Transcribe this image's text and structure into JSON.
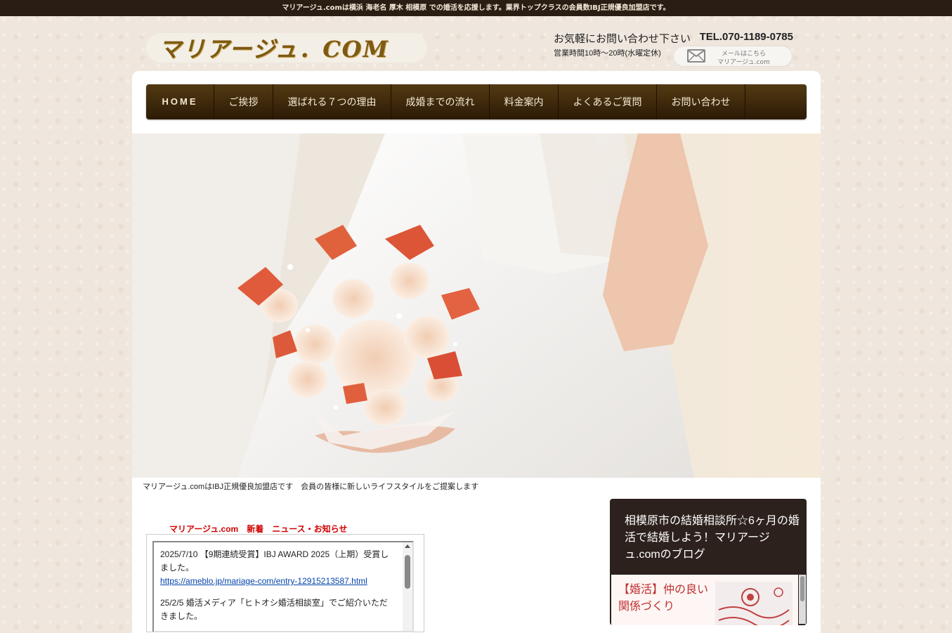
{
  "topbar": {
    "text": "マリアージュ.comは横浜 海老名 厚木 相模原 での婚活を応援します。業界トップクラスの会員数IBJ正規優良加盟店です。"
  },
  "logo": {
    "text": "マリアージュ．COM"
  },
  "contact": {
    "invite": "お気軽にお問い合わせ下さい",
    "tel": "TEL.070-1189-0785",
    "hours": "営業時間10時〜20時(水曜定休)",
    "mail_line1": "メールはこちら",
    "mail_line2": "マリアージュ.com",
    "mail_icon": "envelope-icon"
  },
  "nav": [
    {
      "label": "HOME"
    },
    {
      "label": "ご挨拶"
    },
    {
      "label": "選ばれる７つの理由"
    },
    {
      "label": "成婚までの流れ"
    },
    {
      "label": "料金案内"
    },
    {
      "label": "よくあるご質問"
    },
    {
      "label": "お問い合わせ"
    }
  ],
  "hero": {
    "caption": "マリアージュ.comはIBJ正規優良加盟店です　会員の皆様に新しいライフスタイルをご提案します"
  },
  "news": {
    "title": "マリアージュ.com　新着　ニュース・お知らせ",
    "items": [
      {
        "text": "2025/7/10 【9期連続受賞】IBJ AWARD 2025（上期）受賞しました。",
        "link": "https://ameblo.jp/mariage-com/entry-12915213587.html"
      },
      {
        "text": "25/2/5 婚活メディア「ヒトオシ婚活相談室」でご紹介いただきました。"
      }
    ]
  },
  "blog": {
    "title": "相模原市の結婚相談所☆6ヶ月の婚活で結婚しよう！マリアージュ.comのブログ",
    "entry_title": "【婚活】仲の良い関係づくり"
  },
  "colors": {
    "nav_bg": "#3b270b",
    "topbar_bg": "#2a1d14",
    "news_title": "#d10000",
    "blog_bg": "#2d211d"
  }
}
